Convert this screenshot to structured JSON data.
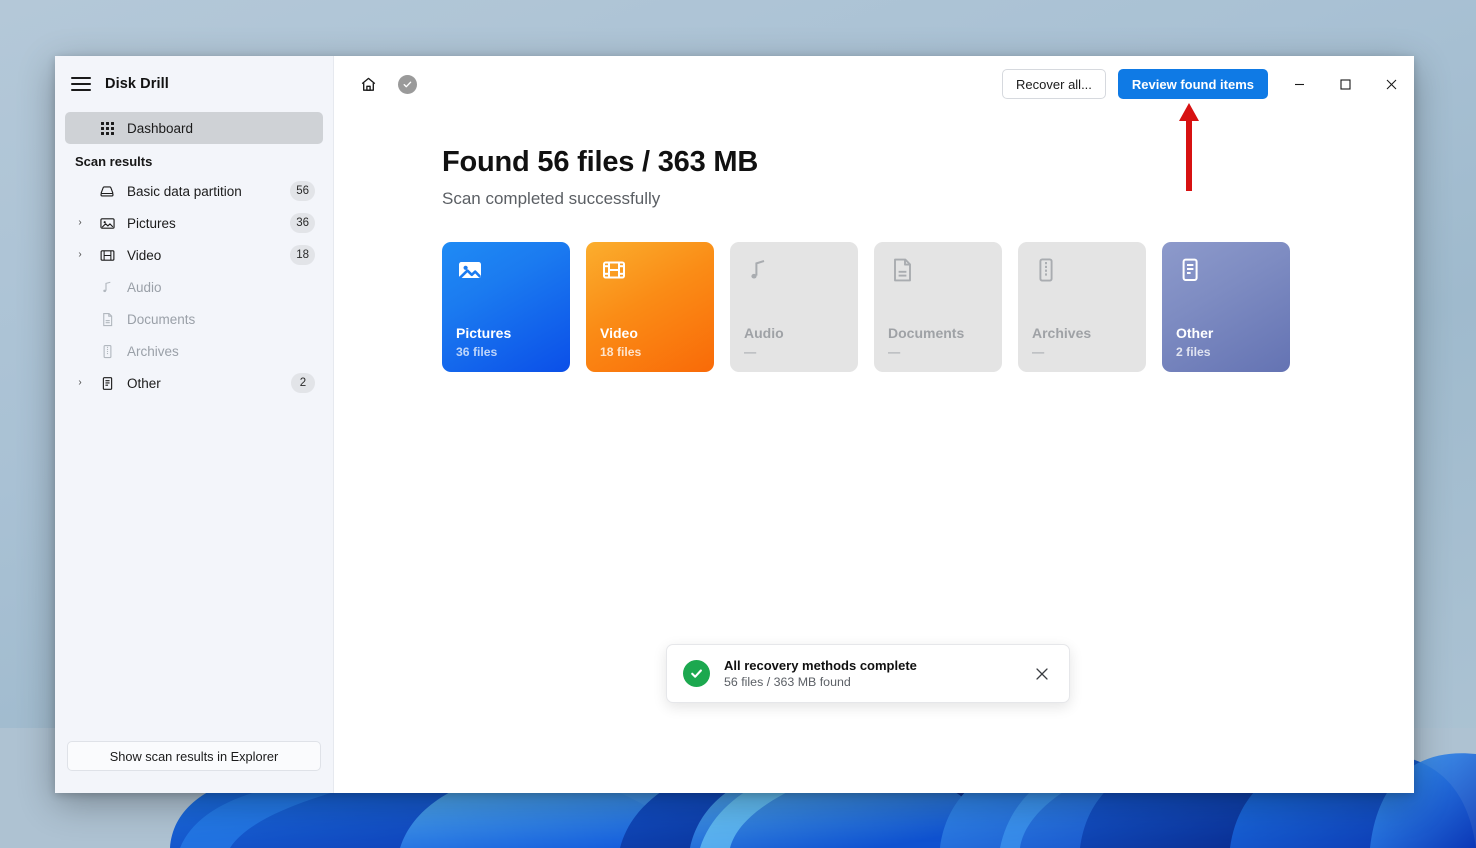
{
  "window": {
    "app_title": "Disk Drill",
    "menu_icon": "hamburger-icon",
    "controls": {
      "minimize": "–",
      "maximize": "□",
      "close": "✕"
    }
  },
  "toolbar": {
    "home_icon": "home-icon",
    "status_icon": "check-circle-icon",
    "recover_all_label": "Recover all...",
    "review_found_label": "Review found items",
    "accent_color": "#0f7ae5"
  },
  "sidebar": {
    "dashboard": {
      "label": "Dashboard",
      "icon": "grid-icon",
      "selected": true
    },
    "section_label": "Scan results",
    "items": [
      {
        "label": "Basic data partition",
        "icon": "disk-icon",
        "badge": "56",
        "expandable": false,
        "dim": false
      },
      {
        "label": "Pictures",
        "icon": "image-icon",
        "badge": "36",
        "expandable": true,
        "dim": false
      },
      {
        "label": "Video",
        "icon": "film-icon",
        "badge": "18",
        "expandable": true,
        "dim": false
      },
      {
        "label": "Audio",
        "icon": "music-icon",
        "badge": "",
        "expandable": false,
        "dim": true
      },
      {
        "label": "Documents",
        "icon": "document-icon",
        "badge": "",
        "expandable": false,
        "dim": true
      },
      {
        "label": "Archives",
        "icon": "archive-icon",
        "badge": "",
        "expandable": false,
        "dim": true
      },
      {
        "label": "Other",
        "icon": "other-icon",
        "badge": "2",
        "expandable": true,
        "dim": false
      }
    ],
    "footer_button": "Show scan results in Explorer"
  },
  "main": {
    "headline": "Found 56 files / 363 MB",
    "subhead": "Scan completed successfully",
    "cards": [
      {
        "name": "Pictures",
        "count": "36 files",
        "icon": "image-icon",
        "state": "pictures"
      },
      {
        "name": "Video",
        "count": "18 files",
        "icon": "film-icon",
        "state": "video"
      },
      {
        "name": "Audio",
        "count": "—",
        "icon": "music-icon",
        "state": "disabled"
      },
      {
        "name": "Documents",
        "count": "—",
        "icon": "document-icon",
        "state": "disabled"
      },
      {
        "name": "Archives",
        "count": "—",
        "icon": "archive-icon",
        "state": "disabled"
      },
      {
        "name": "Other",
        "count": "2 files",
        "icon": "other-icon",
        "state": "other"
      }
    ]
  },
  "toast": {
    "icon": "success-check-icon",
    "title": "All recovery methods complete",
    "subtitle": "56 files / 363 MB found",
    "close_icon": "close-icon"
  },
  "annotation": {
    "arrow_icon": "up-arrow-annotation",
    "color": "#d71111"
  }
}
